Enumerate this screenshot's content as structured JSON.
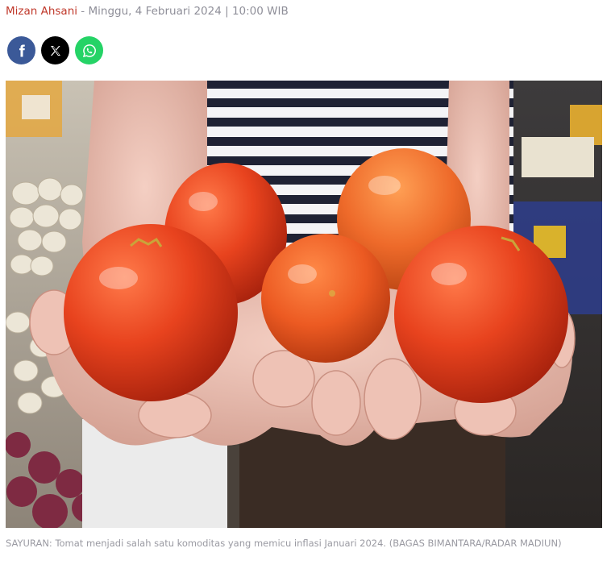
{
  "byline": {
    "author": "Mizan Ahsani",
    "separator": " - ",
    "datetime": "Minggu, 4 Februari 2024 | 10:00 WIB"
  },
  "share": {
    "buttons": [
      {
        "icon": "facebook-icon",
        "color": "#3b5998"
      },
      {
        "icon": "x-icon",
        "color": "#000000"
      },
      {
        "icon": "whatsapp-icon",
        "color": "#25d366"
      }
    ]
  },
  "photo": {
    "subject": "photo-of-tomatoes-in-hands"
  },
  "caption": {
    "text": "SAYURAN: Tomat menjadi salah satu komoditas yang memicu inflasi Januari 2024. (BAGAS BIMANTARA/RADAR MADIUN)"
  }
}
